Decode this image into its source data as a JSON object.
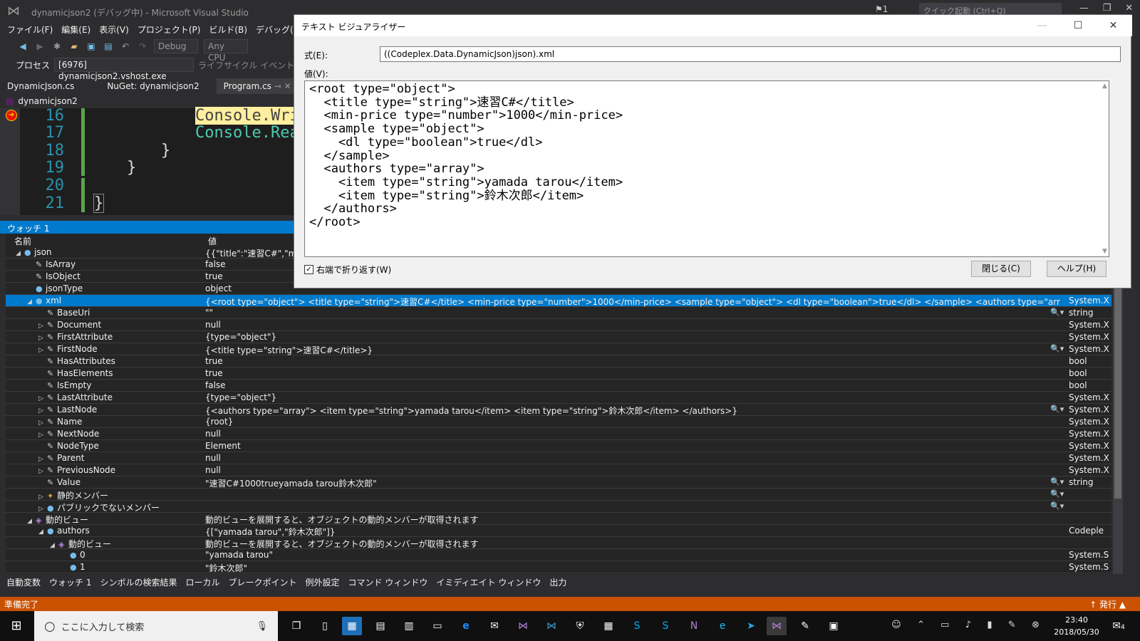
{
  "window": {
    "title": "dynamicjson2 (デバッグ中) - Microsoft Visual Studio",
    "notification_count": "1",
    "quick_launch_placeholder": "クイック起動 (Ctrl+Q)"
  },
  "menu": [
    "ファイル(F)",
    "編集(E)",
    "表示(V)",
    "プロジェクト(P)",
    "ビルド(B)",
    "デバッグ(D)"
  ],
  "toolbar": {
    "config": "Debug",
    "platform": "Any CPU",
    "process_label": "プロセス",
    "process_value": "[6976] dynamicjson2.vshost.exe",
    "lifecycle": "ライフサイクル イベント"
  },
  "doc_tabs": [
    "DynamicJson.cs",
    "NuGet: dynamicjson2",
    "Program.cs"
  ],
  "nav_project": "dynamicjson2",
  "code": {
    "line_numbers": [
      "16",
      "17",
      "18",
      "19",
      "20",
      "21"
    ],
    "lines": [
      "Console.Wri",
      "Console.Rea",
      "}",
      "}",
      "}"
    ]
  },
  "watch": {
    "title": "ウォッチ 1",
    "col_name": "名前",
    "col_value": "値",
    "rows": [
      {
        "name": "json",
        "value": "{{\"title\":\"速習C#\",\"min-",
        "type": "",
        "indent": 1,
        "exp": "◢",
        "ico": "●"
      },
      {
        "name": "IsArray",
        "value": "false",
        "type": "",
        "indent": 2,
        "exp": "",
        "ico": "✎"
      },
      {
        "name": "IsObject",
        "value": "true",
        "type": "",
        "indent": 2,
        "exp": "",
        "ico": "✎"
      },
      {
        "name": "jsonType",
        "value": "object",
        "type": "",
        "indent": 2,
        "exp": "",
        "ico": "●"
      },
      {
        "name": "xml",
        "value": "{<root type=\"object\">  <title type=\"string\">速習C#</title>  <min-price type=\"number\">1000</min-price>  <sample type=\"object\">   <dl type=\"boolean\">true</dl>  </sample>  <authors type=\"array\">   <item type=\"string\">",
        "type": "System.X",
        "indent": 2,
        "exp": "◢",
        "ico": "●",
        "sel": true
      },
      {
        "name": "BaseUri",
        "value": "\"\"",
        "type": "string",
        "indent": 3,
        "exp": "",
        "ico": "✎",
        "mag": true
      },
      {
        "name": "Document",
        "value": "null",
        "type": "System.X",
        "indent": 3,
        "exp": "▷",
        "ico": "✎"
      },
      {
        "name": "FirstAttribute",
        "value": "{type=\"object\"}",
        "type": "System.X",
        "indent": 3,
        "exp": "▷",
        "ico": "✎"
      },
      {
        "name": "FirstNode",
        "value": "{<title type=\"string\">速習C#</title>}",
        "type": "System.X",
        "indent": 3,
        "exp": "▷",
        "ico": "✎",
        "mag": true
      },
      {
        "name": "HasAttributes",
        "value": "true",
        "type": "bool",
        "indent": 3,
        "exp": "",
        "ico": "✎"
      },
      {
        "name": "HasElements",
        "value": "true",
        "type": "bool",
        "indent": 3,
        "exp": "",
        "ico": "✎"
      },
      {
        "name": "IsEmpty",
        "value": "false",
        "type": "bool",
        "indent": 3,
        "exp": "",
        "ico": "✎"
      },
      {
        "name": "LastAttribute",
        "value": "{type=\"object\"}",
        "type": "System.X",
        "indent": 3,
        "exp": "▷",
        "ico": "✎"
      },
      {
        "name": "LastNode",
        "value": "{<authors type=\"array\">  <item type=\"string\">yamada tarou</item>  <item type=\"string\">鈴木次郎</item> </authors>}",
        "type": "System.X",
        "indent": 3,
        "exp": "▷",
        "ico": "✎",
        "mag": true
      },
      {
        "name": "Name",
        "value": "{root}",
        "type": "System.X",
        "indent": 3,
        "exp": "▷",
        "ico": "✎"
      },
      {
        "name": "NextNode",
        "value": "null",
        "type": "System.X",
        "indent": 3,
        "exp": "▷",
        "ico": "✎"
      },
      {
        "name": "NodeType",
        "value": "Element",
        "type": "System.X",
        "indent": 3,
        "exp": "",
        "ico": "✎"
      },
      {
        "name": "Parent",
        "value": "null",
        "type": "System.X",
        "indent": 3,
        "exp": "▷",
        "ico": "✎"
      },
      {
        "name": "PreviousNode",
        "value": "null",
        "type": "System.X",
        "indent": 3,
        "exp": "▷",
        "ico": "✎"
      },
      {
        "name": "Value",
        "value": "\"速習C#1000trueyamada tarou鈴木次郎\"",
        "type": "string",
        "indent": 3,
        "exp": "",
        "ico": "✎",
        "mag": true
      },
      {
        "name": "静的メンバー",
        "value": "",
        "type": "",
        "indent": 3,
        "exp": "▷",
        "ico": "✦",
        "mag": true
      },
      {
        "name": "パブリックでないメンバー",
        "value": "",
        "type": "",
        "indent": 3,
        "exp": "▷",
        "ico": "●",
        "mag": true
      },
      {
        "name": "動的ビュー",
        "value": "動的ビューを展開すると、オブジェクトの動的メンバーが取得されます",
        "type": "",
        "indent": 2,
        "exp": "◢",
        "ico": "◈"
      },
      {
        "name": "authors",
        "value": "{[\"yamada tarou\",\"鈴木次郎\"]}",
        "type": "Codeple",
        "indent": 3,
        "exp": "◢",
        "ico": "●"
      },
      {
        "name": "動的ビュー",
        "value": "動的ビューを展開すると、オブジェクトの動的メンバーが取得されます",
        "type": "",
        "indent": 4,
        "exp": "◢",
        "ico": "◈"
      },
      {
        "name": "0",
        "value": "\"yamada tarou\"",
        "type": "System.S",
        "indent": 5,
        "exp": "",
        "ico": "●"
      },
      {
        "name": "1",
        "value": "\"鈴木次郎\"",
        "type": "System.S",
        "indent": 5,
        "exp": "",
        "ico": "●"
      }
    ]
  },
  "bottom_tabs": [
    "自動変数",
    "ウォッチ 1",
    "シンボルの検索結果",
    "ローカル",
    "ブレークポイント",
    "例外設定",
    "コマンド ウィンドウ",
    "イミディエイト ウィンドウ",
    "出力"
  ],
  "status": {
    "left": "準備完了",
    "right": "↑ 発行 ▲"
  },
  "dialog": {
    "title": "テキスト ビジュアライザー",
    "expr_label": "式(E):",
    "expr_value": "((Codeplex.Data.DynamicJson)json).xml",
    "value_label": "値(V):",
    "text": "<root type=\"object\">\n  <title type=\"string\">速習C#</title>\n  <min-price type=\"number\">1000</min-price>\n  <sample type=\"object\">\n    <dl type=\"boolean\">true</dl>\n  </sample>\n  <authors type=\"array\">\n    <item type=\"string\">yamada tarou</item>\n    <item type=\"string\">鈴木次郎</item>\n  </authors>\n</root>",
    "wrap_label": "右端で折り返す(W)",
    "wrap_checked": true,
    "close_button": "閉じる(C)",
    "help_button": "ヘルプ(H)"
  },
  "taskbar": {
    "search_placeholder": "ここに入力して検索",
    "time": "23:40",
    "date": "2018/05/30",
    "notification_badge": "4"
  }
}
